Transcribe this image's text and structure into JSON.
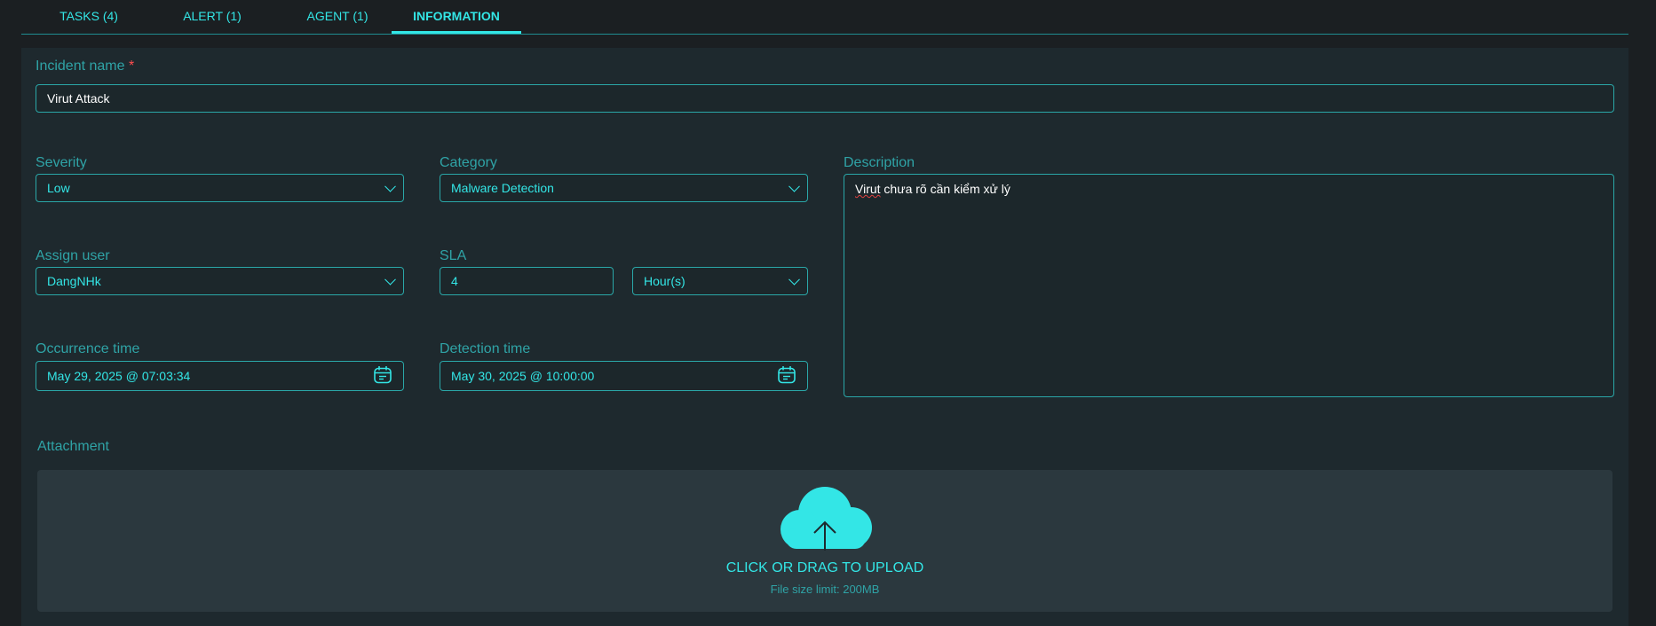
{
  "tabs": [
    {
      "label": "TASKS (4)"
    },
    {
      "label": "ALERT (1)"
    },
    {
      "label": "AGENT (1)"
    },
    {
      "label": "INFORMATION",
      "active": true
    }
  ],
  "incident_name": {
    "label": "Incident name",
    "required_mark": "*",
    "value": "Virut Attack"
  },
  "severity": {
    "label": "Severity",
    "value": "Low"
  },
  "category": {
    "label": "Category",
    "value": "Malware Detection"
  },
  "description": {
    "label": "Description",
    "value_parts": {
      "misspelled": "Virut",
      "rest": " chưa rõ cần kiểm xử lý"
    }
  },
  "assign_user": {
    "label": "Assign user",
    "value": "DangNHk"
  },
  "sla": {
    "label": "SLA",
    "value": "4",
    "unit": "Hour(s)"
  },
  "occurrence_time": {
    "label": "Occurrence time",
    "value": "May 29, 2025 @ 07:03:34"
  },
  "detection_time": {
    "label": "Detection time",
    "value": "May 30, 2025 @ 10:00:00"
  },
  "attachment": {
    "label": "Attachment",
    "upload_text": "CLICK OR DRAG TO UPLOAD",
    "limit_text": "File size limit: 200MB"
  },
  "icons": {
    "select": "chevron-down-icon",
    "date": "calendar-icon",
    "upload": "cloud-upload-icon"
  },
  "colors": {
    "accent": "#33e6e6",
    "label": "#2fa3a6",
    "border": "#2aa7a8",
    "background": "#1b1f22",
    "panel": "#1e292e",
    "required": "#ff4d4f"
  }
}
